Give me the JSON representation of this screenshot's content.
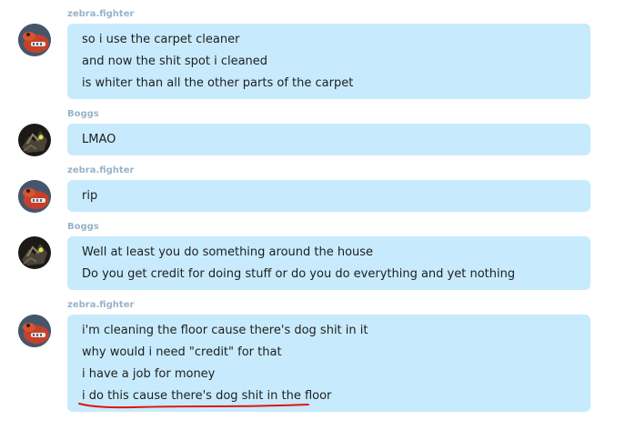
{
  "colors": {
    "bubble": "#c7ebfc",
    "sender": "#98b3c9",
    "text": "#1e1e1e",
    "annotation": "#e01414"
  },
  "messages": [
    {
      "sender": "zebra.fighter",
      "avatar": "zebra-avatar",
      "lines": [
        "so i use the carpet cleaner",
        "and now the shit spot i cleaned",
        "is whiter than all the other parts of the carpet"
      ]
    },
    {
      "sender": "Boggs",
      "avatar": "boggs-avatar",
      "lines": [
        "LMAO"
      ]
    },
    {
      "sender": "zebra.fighter",
      "avatar": "zebra-avatar",
      "lines": [
        "rip"
      ]
    },
    {
      "sender": "Boggs",
      "avatar": "boggs-avatar",
      "lines": [
        "Well at least you do something around the house",
        "Do you get credit for doing stuff or do you do everything and yet nothing"
      ]
    },
    {
      "sender": "zebra.fighter",
      "avatar": "zebra-avatar",
      "lines": [
        "i'm cleaning the floor cause there's dog shit in it",
        "why would i need \"credit\" for that",
        "i have a job for money",
        "i do this cause there's dog shit in the floor"
      ]
    }
  ]
}
